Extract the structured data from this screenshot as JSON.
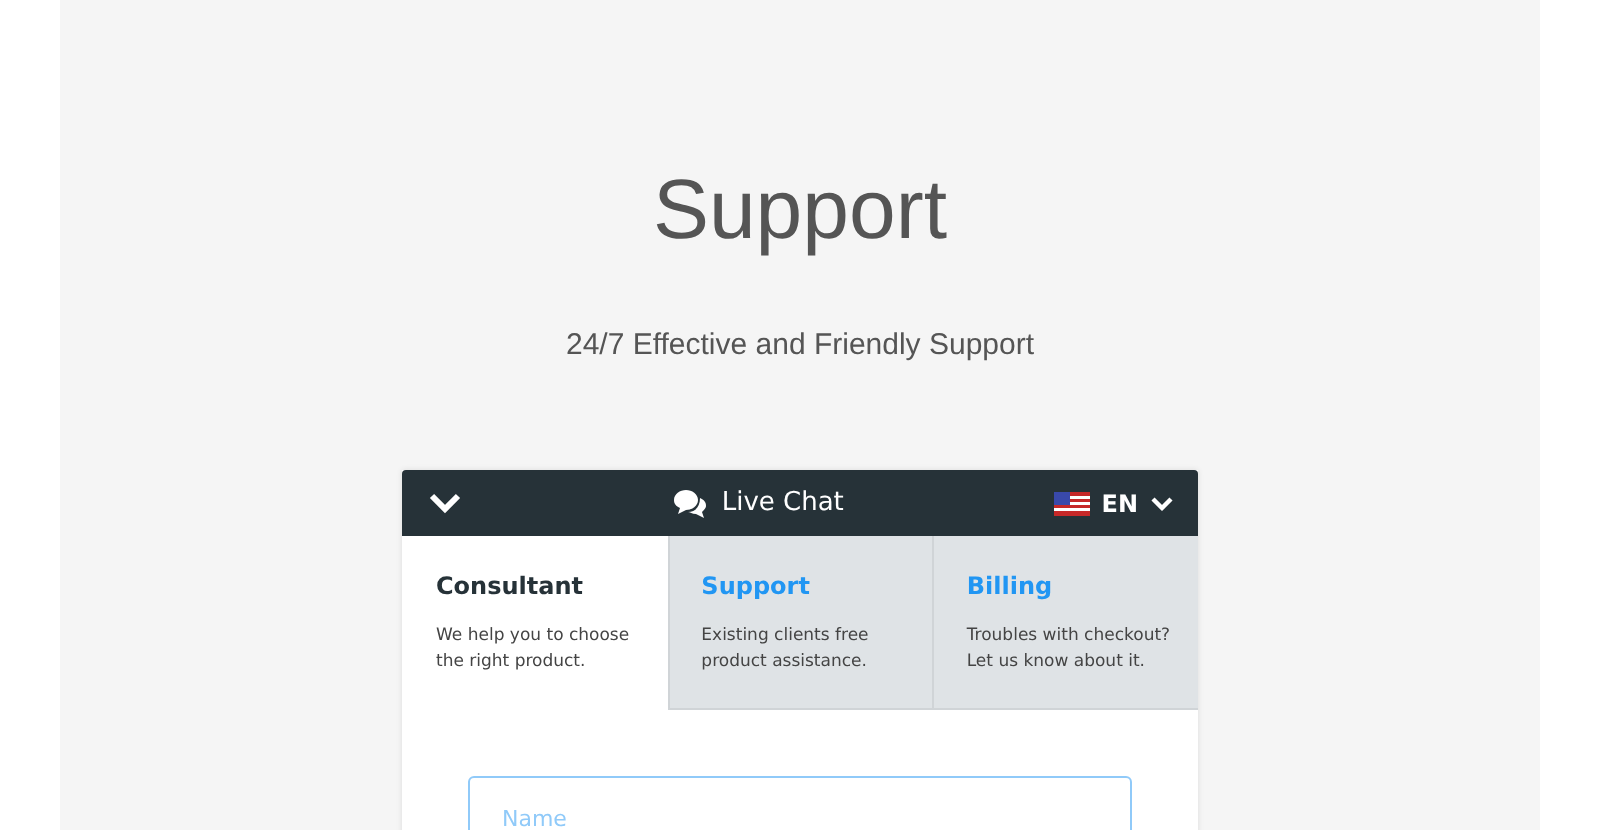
{
  "title": "Support",
  "subtitle": "24/7 Effective and Friendly Support",
  "widget": {
    "title": "Live Chat",
    "language": "EN",
    "tabs": [
      {
        "label": "Consultant",
        "description": "We help you to choose the right product.",
        "selected": true
      },
      {
        "label": "Support",
        "description": "Existing clients free product assistance.",
        "selected": false
      },
      {
        "label": "Billing",
        "description": "Troubles with checkout? Let us know about it.",
        "selected": false
      }
    ],
    "name_field": {
      "placeholder": "Name"
    }
  }
}
